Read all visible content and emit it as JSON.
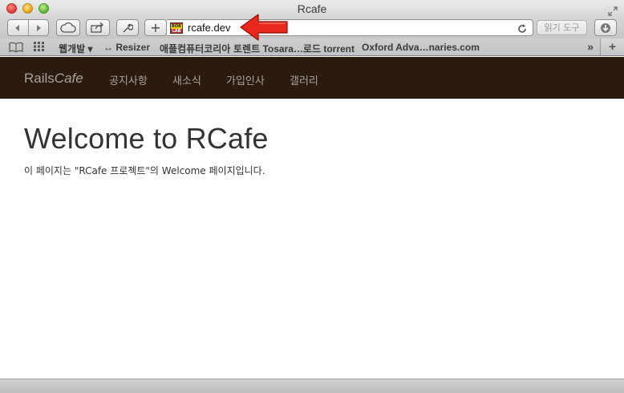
{
  "window": {
    "title": "Rcafe"
  },
  "toolbar": {
    "plus_label": "+",
    "reader_label": "읽기 도구"
  },
  "address": {
    "url": "rcafe.dev",
    "favicon_top": "ROR",
    "favicon_bottom": "LAB"
  },
  "bookmarks": {
    "items": [
      {
        "label": "웹개발 ▾"
      },
      {
        "label": "↔ Resizer"
      },
      {
        "label": "애플컴퓨터코리아"
      },
      {
        "label": "토렌트 Tosara…로드 torrent"
      },
      {
        "label": "Oxford Adva…naries.com"
      }
    ],
    "more": "»",
    "new_tab": "+"
  },
  "site": {
    "brand_plain": "Rails",
    "brand_italic": "Cafe",
    "nav": [
      {
        "label": "공지사항"
      },
      {
        "label": "새소식"
      },
      {
        "label": "가입인사"
      },
      {
        "label": "갤러리"
      }
    ],
    "nav_background": "#2b1b0f",
    "headline": "Welcome to RCafe",
    "intro": "이 페이지는 \"RCafe 프로젝트\"의 Welcome 페이지입니다."
  },
  "annotation": {
    "arrow_color": "#e8281c"
  },
  "icons": [
    "close",
    "minimize",
    "maximize",
    "fullscreen-icon",
    "back-icon",
    "forward-icon",
    "cloud-icon",
    "share-icon",
    "wrench-icon",
    "reload-icon",
    "download-icon",
    "book-icon",
    "grid-icon",
    "red-arrow-icon"
  ]
}
